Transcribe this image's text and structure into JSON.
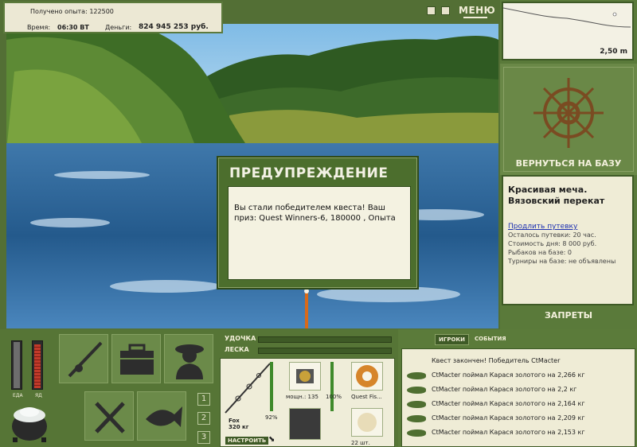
{
  "header": {
    "experience_label": "Получено опыта:",
    "experience_value": "122500",
    "time_label": "Время:",
    "time_value": "06:30 ВТ",
    "money_label": "Деньги:",
    "money_value": "824 945 253 руб.",
    "menu_label": "МЕНЮ"
  },
  "depth": {
    "value": "2,50 m"
  },
  "base": {
    "return_label": "ВЕРНУТЬСЯ НА БАЗУ",
    "name_line1": "Красивая меча.",
    "name_line2": "Вязовский перекат",
    "extend_link": "Продлить путевку",
    "remaining": "Осталось путевки: 20 час.",
    "day_cost": "Стоимость дня: 8 000 руб.",
    "anglers": "Рыбаков на базе: 0",
    "tournaments": "Турниры на базе: не объявлены",
    "bans_label": "ЗАПРЕТЫ"
  },
  "dialog": {
    "title": "ПРЕДУПРЕЖДЕНИЕ",
    "message": "Вы стали победителем квеста! Ваш приз: Quest Winners-6, 180000 , Опыта"
  },
  "status": {
    "food_label": "ЕДА",
    "poison_label": "ЯД"
  },
  "pages": [
    "1",
    "2",
    "3"
  ],
  "rod": {
    "rod_label": "УДОЧКА",
    "line_label": "ЛЕСКА",
    "rod_name": "Fox",
    "rod_weight": "320 кг",
    "rod_pct": "92%",
    "reel_power": "мощн.: 135",
    "reel_pct": "100%",
    "line_name": "Quest Fis...",
    "bait_count": "22 шт.",
    "setup_label": "НАСТРОИТЬ"
  },
  "events": {
    "tab_players": "ИГРОКИ",
    "tab_events": "СОБЫТИЯ",
    "items": [
      "Квест закончен! Победитель CtMacter",
      "CtMacter поймал Карася золотого на 2,266 кг",
      "CtMacter поймал Карася золотого на 2,2 кг",
      "CtMacter поймал Карася золотого на 2,164 кг",
      "CtMacter поймал Карася золотого на 2,209 кг",
      "CtMacter поймал Карася золотого на 2,153 кг"
    ]
  },
  "levels": {
    "food": 1.0,
    "poison": 0.95
  },
  "colors": {
    "panel_green": "#536f35",
    "cream": "#efecd6",
    "link_blue": "#1c2fb0"
  }
}
